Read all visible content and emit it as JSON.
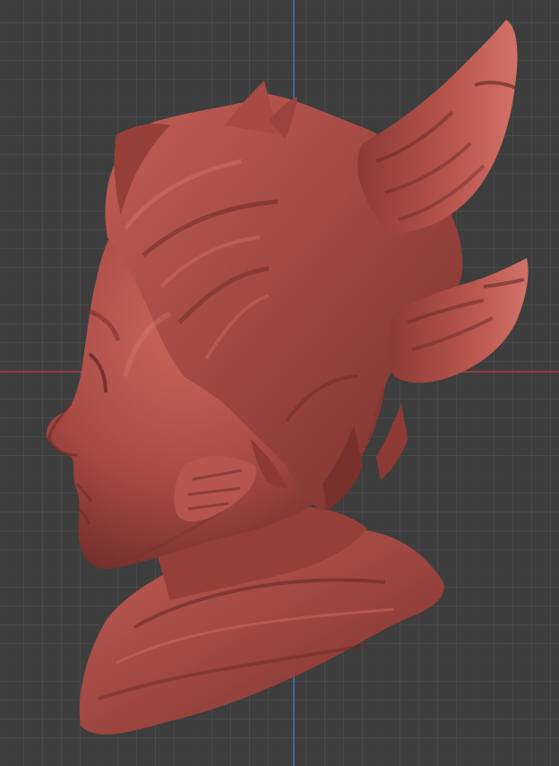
{
  "viewport": {
    "grid": "on",
    "axes": [
      "x-axis",
      "z-axis"
    ],
    "colors": {
      "background": "#3d3d3d",
      "x_axis": "#9c3a42",
      "z_axis": "#4a6aa6",
      "clay": "#a84a44",
      "clay_light": "#c9665b",
      "clay_dark": "#6b2a27"
    }
  },
  "model": {
    "name": "sculpted-head-with-horns",
    "material": "red-clay"
  }
}
